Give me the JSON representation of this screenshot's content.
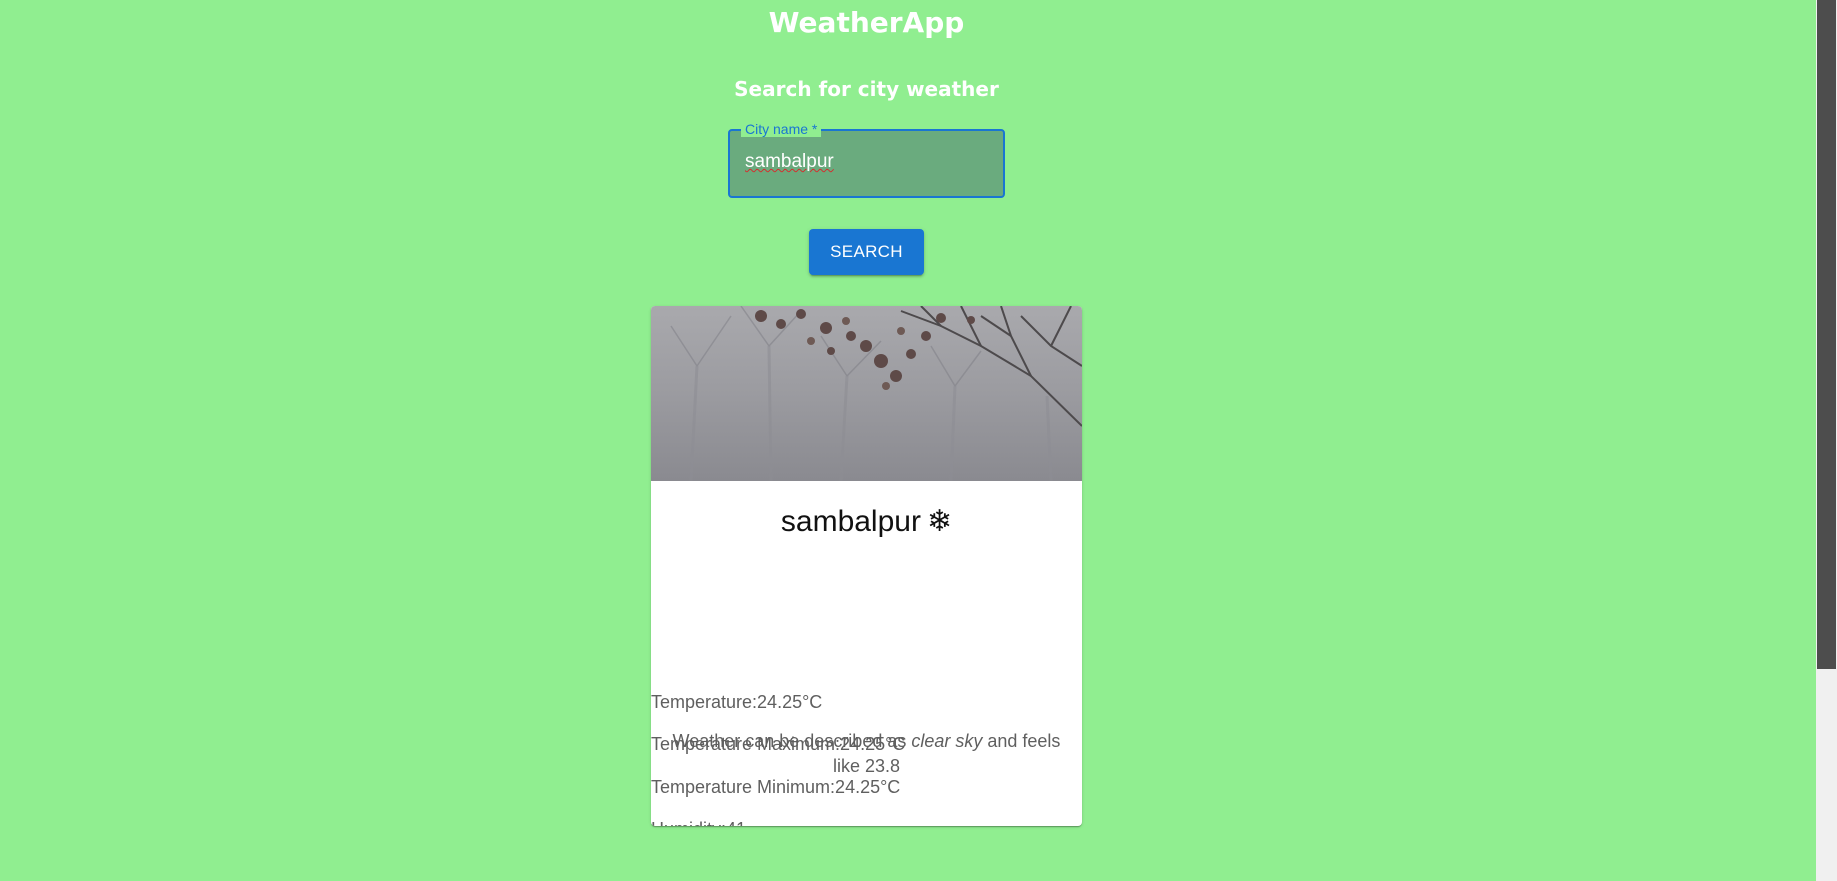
{
  "app": {
    "title": "WeatherApp",
    "subtitle": "Search for city weather"
  },
  "search": {
    "label": "City name *",
    "value": "sambalpur",
    "button_label": "SEARCH"
  },
  "card": {
    "image_icon": "foggy-trees-image",
    "city": "sambalpur",
    "condition_icon": "snowflake-icon",
    "condition_glyph": "❄",
    "temperature": "Temperature:24.25°C",
    "temperature_max": "Temperature Maximum:24.25°C",
    "temperature_min": "Temperature Minimum:24.25°C",
    "humidity": "Humidity:41",
    "description_prefix": "Weather can be described as ",
    "description_condition": "clear sky",
    "description_suffix": " and feels like 23.8"
  },
  "colors": {
    "background": "#90ee90",
    "primary": "#1976d2",
    "input_fill": "#6aab7e"
  }
}
